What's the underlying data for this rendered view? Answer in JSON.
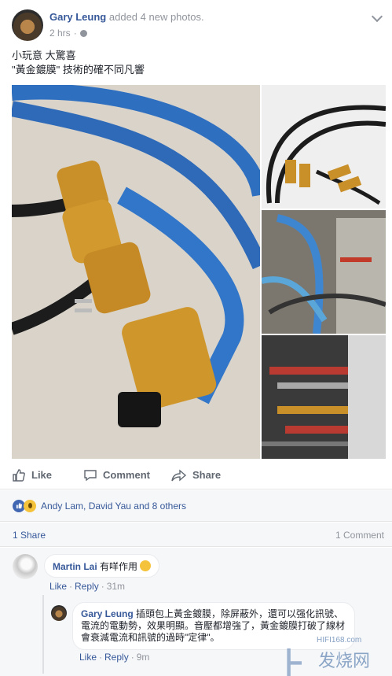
{
  "post": {
    "author": "Gary Leung",
    "action": "added 4 new photos.",
    "time": "2 hrs",
    "text_line1": "小玩意 大驚喜",
    "text_line2": "\"黃金鍍膜\" 技術的確不同凡響"
  },
  "actions": {
    "like": "Like",
    "comment": "Comment",
    "share": "Share"
  },
  "reactions": {
    "names": "Andy Lam, David Yau and 8 others"
  },
  "counts": {
    "shares": "1 Share",
    "comments": "1 Comment"
  },
  "comment1": {
    "author": "Martin Lai",
    "text": "有咩作用",
    "like": "Like",
    "reply": "Reply",
    "time": "31m"
  },
  "comment2": {
    "author": "Gary Leung",
    "text": "插頭包上黃金鍍膜，除屏蔽外，還可以强化訊號、電流的電動勢，效果明顯。音壓都增強了，黃金鍍膜打破了線材會衰減電流和訊號的過時\"定律\"。",
    "like": "Like",
    "reply": "Reply",
    "time": "9m"
  },
  "watermark": {
    "url": "HIFI168.com",
    "cn": "发烧网"
  },
  "colors": {
    "link": "#365899",
    "muted": "#90949c",
    "cable_blue": "#2f6fc0",
    "gold": "#c9902a"
  }
}
